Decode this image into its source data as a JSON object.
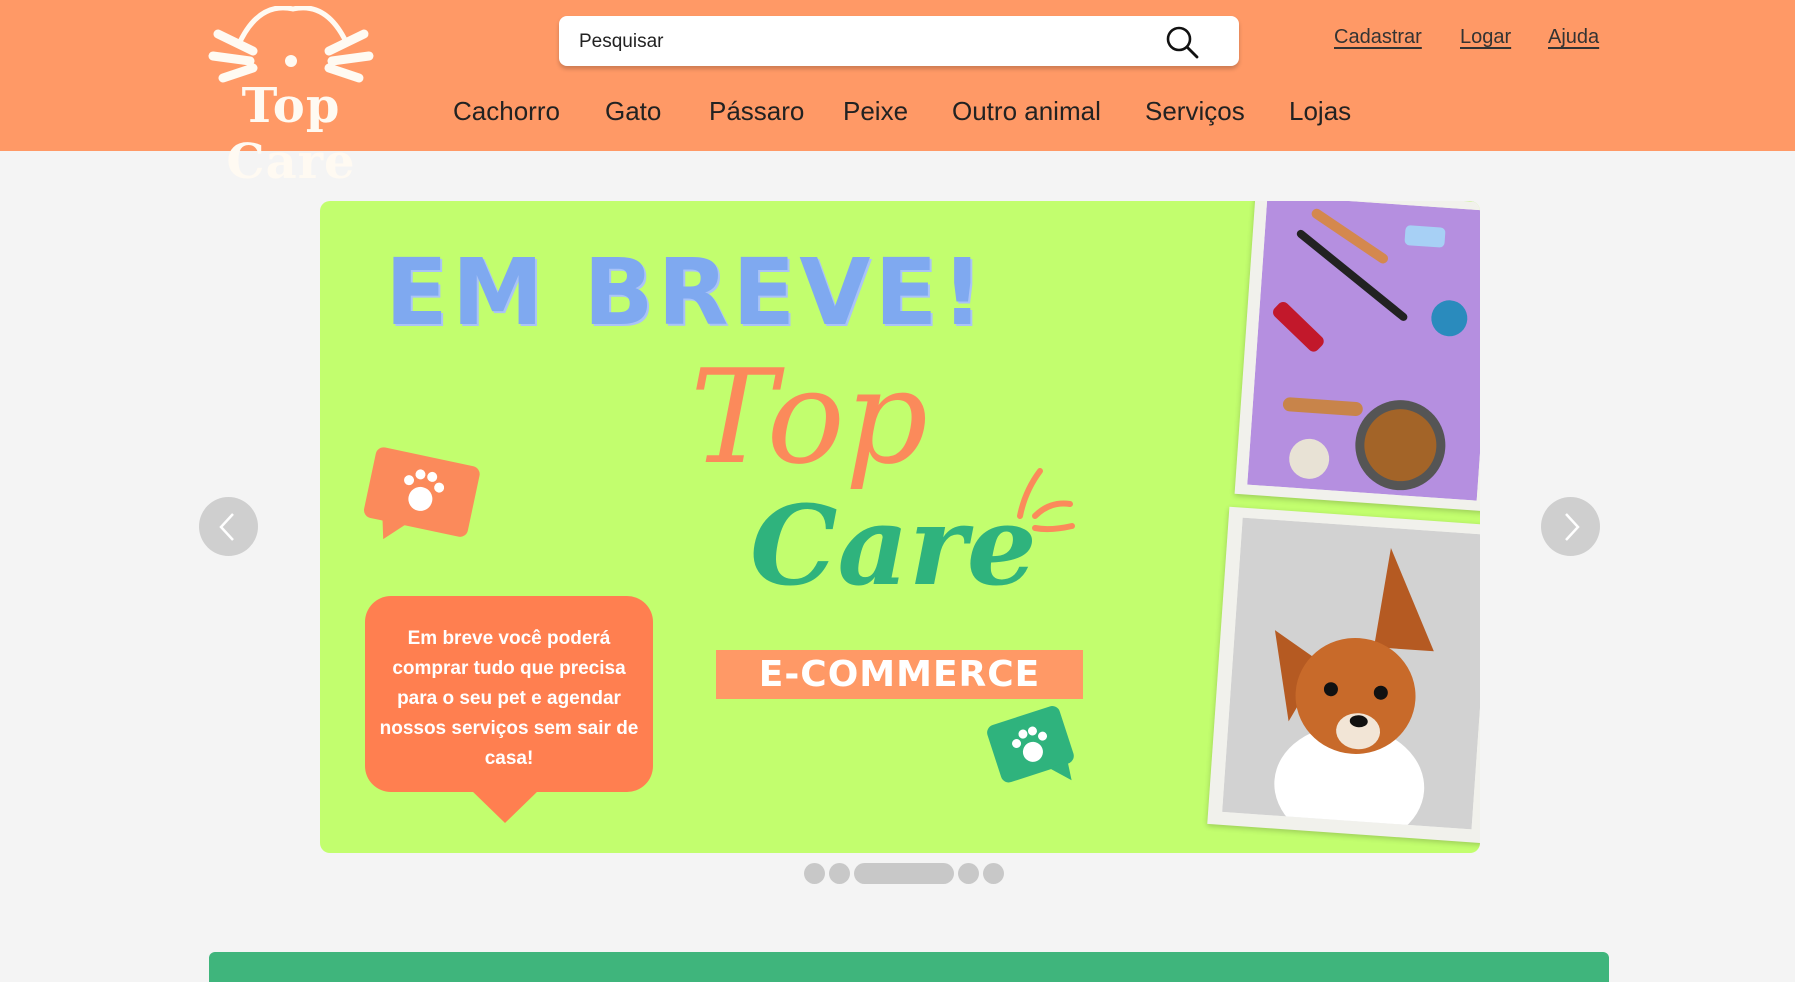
{
  "header": {
    "logo_text": "Top Care",
    "search": {
      "placeholder": "Pesquisar"
    },
    "top_links": [
      "Cadastrar",
      "Logar",
      "Ajuda"
    ],
    "nav": [
      "Cachorro",
      "Gato",
      "Pássaro",
      "Peixe",
      "Outro animal",
      "Serviços",
      "Lojas"
    ]
  },
  "banner": {
    "headline": "EM BREVE!",
    "brand_top": "Top",
    "brand_care": "Care",
    "tag": "E-COMMERCE",
    "bubble_text": "Em breve você poderá comprar tudo que precisa para o seu pet e agendar nossos serviços sem sair de casa!"
  },
  "carousel": {
    "slide_count": 5,
    "active_index": 2
  },
  "colors": {
    "header": "#ff9966",
    "banner": "#c2fe6e",
    "accent_blue": "#7fa9f0",
    "accent_orange": "#ff7f50",
    "accent_green": "#2fb37d"
  }
}
